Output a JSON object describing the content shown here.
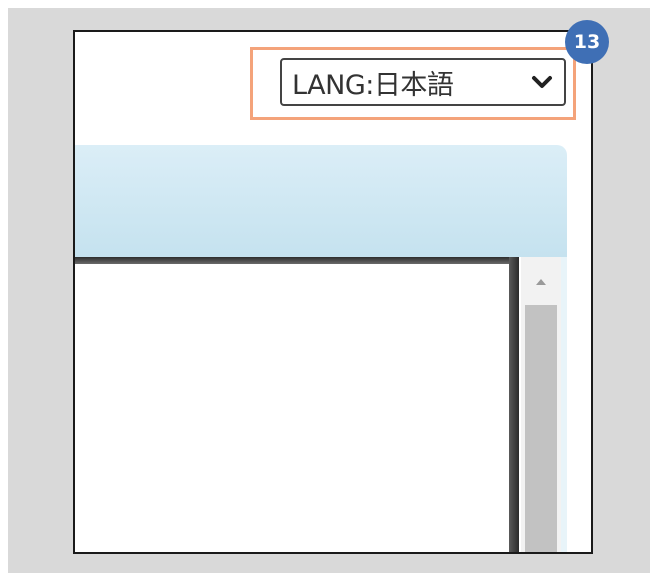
{
  "language_selector": {
    "label": "LANG:日本語"
  },
  "annotation": {
    "step_number": "13"
  },
  "icons": {
    "dropdown": "chevron-down-icon",
    "scroll_up": "scroll-up-arrow-icon"
  },
  "colors": {
    "highlight_border": "#f4a37a",
    "badge_background": "#3f6fb5",
    "header_bar": "#c9e4f0",
    "scroll_thumb": "#c2c2c2"
  }
}
